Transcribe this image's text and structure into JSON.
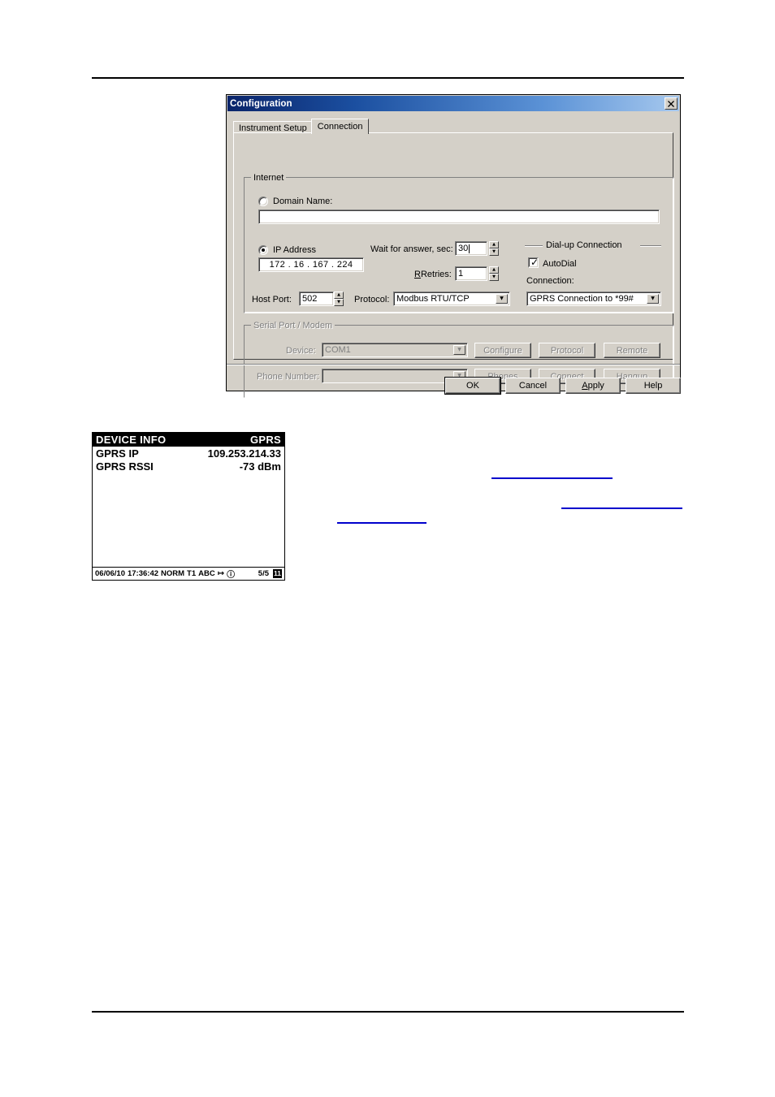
{
  "dialog": {
    "title": "Configuration",
    "close_icon": "close-icon",
    "tabs": [
      {
        "label": "Instrument Setup",
        "active": false
      },
      {
        "label": "Connection",
        "active": true
      }
    ],
    "internet_group": {
      "title": "Internet",
      "domain_name_label": "Domain Name:",
      "domain_name_value": "",
      "domain_name_selected": false,
      "ip_address_label": "IP Address",
      "ip_address_selected": true,
      "ip_octets": [
        "172",
        "16",
        "167",
        "224"
      ],
      "ip_value": "172 . 16 . 167 . 224",
      "wait_for_answer_label": "Wait for answer, sec:",
      "wait_for_answer_value": "30",
      "retries_label": "Retries:",
      "retries_value": "1",
      "host_port_label": "Host Port:",
      "host_port_value": "502",
      "protocol_label": "Protocol:",
      "protocol_value": "Modbus RTU/TCP"
    },
    "dialup_group": {
      "title": "Dial-up Connection",
      "autodial_label": "AutoDial",
      "autodial_checked": true,
      "connection_label": "Connection:",
      "connection_value": "GPRS Connection to *99#"
    },
    "serial_group": {
      "title": "Serial Port / Modem",
      "enabled": false,
      "device_label": "Device:",
      "device_value": "COM1",
      "phone_number_label": "Phone Number:",
      "phone_number_value": "",
      "buttons_row1": [
        "Configure",
        "Protocol",
        "Remote"
      ],
      "buttons_row2": [
        "Phones",
        "Connect",
        "Hangup"
      ]
    },
    "footer_buttons": [
      {
        "label": "OK",
        "default": true,
        "accel": ""
      },
      {
        "label": "Cancel",
        "default": false,
        "accel": ""
      },
      {
        "label": "Apply",
        "default": false,
        "accel": "A"
      },
      {
        "label": "Help",
        "default": false,
        "accel": ""
      }
    ]
  },
  "lcd": {
    "header_left": "DEVICE INFO",
    "header_right": "GPRS",
    "rows": [
      {
        "label": "GPRS IP",
        "value": "109.253.214.33"
      },
      {
        "label": "GPRS RSSI",
        "value": "-73 dBm"
      }
    ],
    "status": {
      "date": "06/06/10",
      "time": "17:36:42",
      "mode": "NORM",
      "trigger": "T1",
      "input_mode": "ABC",
      "arrow_icon": "↦",
      "info_icon": "ⓘ",
      "page": "5/5",
      "badge": "11"
    }
  },
  "links": [
    {
      "name": "hyperlink-1",
      "text": ""
    },
    {
      "name": "hyperlink-2",
      "text": ""
    },
    {
      "name": "hyperlink-3",
      "text": ""
    }
  ],
  "colors": {
    "titlebar_start": "#0a246a",
    "titlebar_end": "#a6c8ee",
    "dialog_face": "#d4d0c8",
    "link": "#0000cc",
    "lcd_bg": "#ffffff",
    "lcd_fg": "#000000"
  }
}
